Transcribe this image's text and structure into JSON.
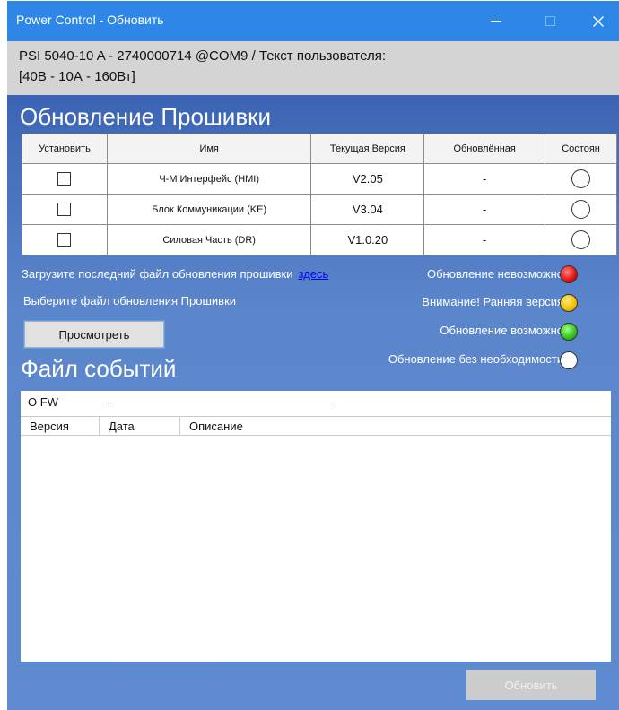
{
  "window": {
    "title": "Power Control - Обновить",
    "controls": {
      "minimize": "minimize-icon",
      "maximize": "maximize-icon",
      "close": "close-icon"
    }
  },
  "device": {
    "line1": "PSI 5040-10 A - 2740000714 @COM9 / Текст пользователя:",
    "line2": "[40В - 10А - 160Вт]"
  },
  "firmware": {
    "title": "Обновление Прошивки",
    "columns": [
      "Установить",
      "Имя",
      "Текущая Версия",
      "Обновлённая",
      "Состоян"
    ],
    "rows": [
      {
        "name": "Ч-М Интерфейс (HMI)",
        "current": "V2.05",
        "updated": "-",
        "checked": false,
        "state": "white"
      },
      {
        "name": "Блок Коммуникации (KE)",
        "current": "V3.04",
        "updated": "-",
        "checked": false,
        "state": "white"
      },
      {
        "name": "Силовая Часть (DR)",
        "current": "V1.0.20",
        "updated": "-",
        "checked": false,
        "state": "white"
      }
    ],
    "download_text": "Загрузите последний файл обновления прошивки",
    "download_link": "здесь",
    "choose_text": "Выберите файл обновления Прошивки",
    "browse_button": "Просмотреть"
  },
  "legend": [
    {
      "label": "Обновление невозможно",
      "color": "#e01010"
    },
    {
      "label": "Внимание! Ранняя версия",
      "color": "#f0c000"
    },
    {
      "label": "Обновление возможно",
      "color": "#30c020"
    },
    {
      "label": "Обновление без необходимости",
      "color": "#ffffff"
    }
  ],
  "events": {
    "title": "Файл событий",
    "fw_row": {
      "label": "О FW",
      "value1": "-",
      "value2": "-"
    },
    "columns": [
      "Версия",
      "Дата",
      "Описание"
    ]
  },
  "update_button": "Обновить"
}
